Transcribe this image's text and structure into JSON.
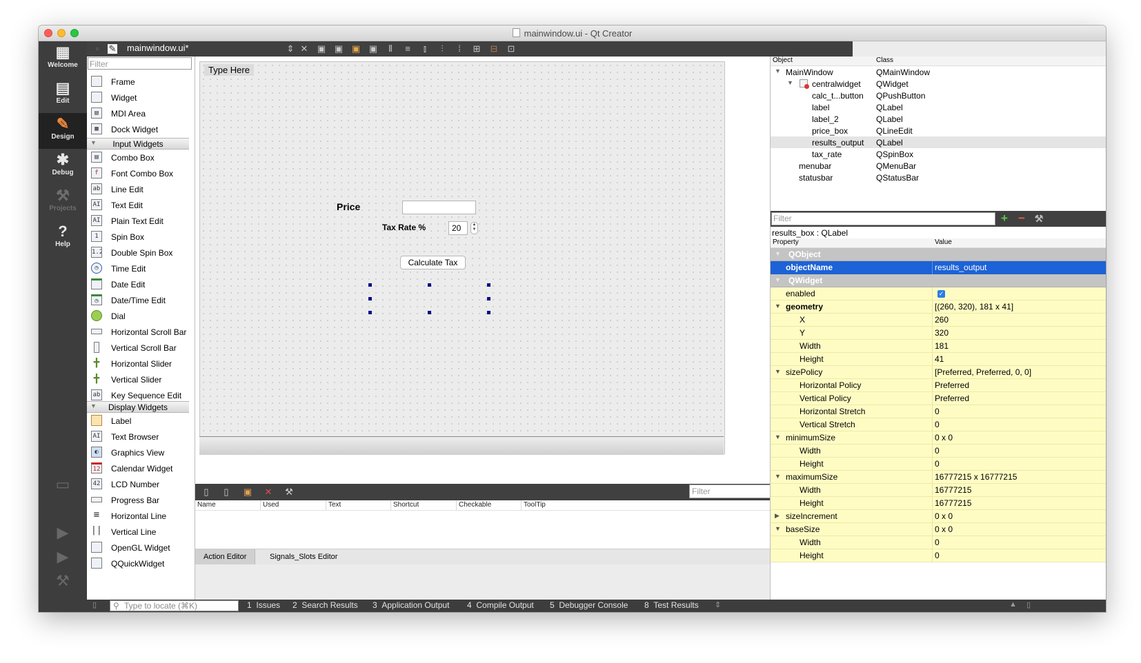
{
  "window": {
    "title": "mainwindow.ui - Qt Creator"
  },
  "modes": [
    {
      "label": "Welcome",
      "icon": "grid-icon",
      "glyph": "▦"
    },
    {
      "label": "Edit",
      "icon": "document-edit-icon",
      "glyph": "▤"
    },
    {
      "label": "Design",
      "icon": "pencil-icon",
      "glyph": "✎"
    },
    {
      "label": "Debug",
      "icon": "bug-icon",
      "glyph": "✱"
    },
    {
      "label": "Projects",
      "icon": "wrench-icon",
      "glyph": "⚒"
    },
    {
      "label": "Help",
      "icon": "help-icon",
      "glyph": "?"
    }
  ],
  "toolbar": {
    "file_name": "mainwindow.ui*"
  },
  "widget_box": {
    "filter_placeholder": "Filter",
    "items_top": [
      {
        "label": "Frame",
        "icon": "frame-icon"
      },
      {
        "label": "Widget",
        "icon": "widget-icon"
      },
      {
        "label": "MDI Area",
        "icon": "mdi-area-icon"
      },
      {
        "label": "Dock Widget",
        "icon": "dock-widget-icon"
      }
    ],
    "input_category": "Input Widgets",
    "input_items": [
      {
        "label": "Combo Box",
        "icon": "combo-box-icon"
      },
      {
        "label": "Font Combo Box",
        "icon": "font-combo-box-icon"
      },
      {
        "label": "Line Edit",
        "icon": "line-edit-icon"
      },
      {
        "label": "Text Edit",
        "icon": "text-edit-icon"
      },
      {
        "label": "Plain Text Edit",
        "icon": "plain-text-edit-icon"
      },
      {
        "label": "Spin Box",
        "icon": "spin-box-icon"
      },
      {
        "label": "Double Spin Box",
        "icon": "double-spin-box-icon"
      },
      {
        "label": "Time Edit",
        "icon": "clock-icon"
      },
      {
        "label": "Date Edit",
        "icon": "calendar-icon"
      },
      {
        "label": "Date/Time Edit",
        "icon": "calendar-clock-icon"
      },
      {
        "label": "Dial",
        "icon": "dial-icon"
      },
      {
        "label": "Horizontal Scroll Bar",
        "icon": "horizontal-scroll-bar-icon"
      },
      {
        "label": "Vertical Scroll Bar",
        "icon": "vertical-scroll-bar-icon"
      },
      {
        "label": "Horizontal Slider",
        "icon": "horizontal-slider-icon"
      },
      {
        "label": "Vertical Slider",
        "icon": "vertical-slider-icon"
      },
      {
        "label": "Key Sequence Edit",
        "icon": "key-sequence-edit-icon"
      }
    ],
    "display_category": "Display Widgets",
    "display_items": [
      {
        "label": "Label",
        "icon": "label-tag-icon"
      },
      {
        "label": "Text Browser",
        "icon": "text-browser-icon"
      },
      {
        "label": "Graphics View",
        "icon": "graphics-view-icon"
      },
      {
        "label": "Calendar Widget",
        "icon": "calendar-widget-icon"
      },
      {
        "label": "LCD Number",
        "icon": "lcd-number-icon"
      },
      {
        "label": "Progress Bar",
        "icon": "progress-bar-icon"
      },
      {
        "label": "Horizontal Line",
        "icon": "horizontal-line-icon"
      },
      {
        "label": "Vertical Line",
        "icon": "vertical-line-icon"
      },
      {
        "label": "OpenGL Widget",
        "icon": "opengl-widget-icon"
      },
      {
        "label": "QQuickWidget",
        "icon": "qquick-widget-icon"
      }
    ]
  },
  "form": {
    "menu_placeholder": "Type Here",
    "price_label": "Price",
    "tax_rate_label": "Tax Rate %",
    "tax_rate_value": "20",
    "calculate_button": "Calculate Tax"
  },
  "action_editor": {
    "filter_placeholder": "Filter",
    "columns": [
      "Name",
      "Used",
      "Text",
      "Shortcut",
      "Checkable",
      "ToolTip"
    ],
    "tabs": [
      "Action Editor",
      "Signals_Slots Editor"
    ]
  },
  "object_inspector": {
    "col_object": "Object",
    "col_class": "Class",
    "rows": [
      {
        "name": "MainWindow",
        "class": "QMainWindow"
      },
      {
        "name": "centralwidget",
        "class": "QWidget"
      },
      {
        "name": "calc_t...button",
        "class": "QPushButton"
      },
      {
        "name": "label",
        "class": "QLabel"
      },
      {
        "name": "label_2",
        "class": "QLabel"
      },
      {
        "name": "price_box",
        "class": "QLineEdit"
      },
      {
        "name": "results_output",
        "class": "QLabel"
      },
      {
        "name": "tax_rate",
        "class": "QSpinBox"
      },
      {
        "name": "menubar",
        "class": "QMenuBar"
      },
      {
        "name": "statusbar",
        "class": "QStatusBar"
      }
    ]
  },
  "property_editor": {
    "filter_placeholder": "Filter",
    "class_label": "results_box : QLabel",
    "col_property": "Property",
    "col_value": "Value",
    "rows": [
      {
        "name": "QObject",
        "value": ""
      },
      {
        "name": "objectName",
        "value": "results_output"
      },
      {
        "name": "QWidget",
        "value": ""
      },
      {
        "name": "enabled",
        "value": "✓"
      },
      {
        "name": "geometry",
        "value": "[(260, 320), 181 x 41]"
      },
      {
        "name": "X",
        "value": "260"
      },
      {
        "name": "Y",
        "value": "320"
      },
      {
        "name": "Width",
        "value": "181"
      },
      {
        "name": "Height",
        "value": "41"
      },
      {
        "name": "sizePolicy",
        "value": "[Preferred, Preferred, 0, 0]"
      },
      {
        "name": "Horizontal Policy",
        "value": "Preferred"
      },
      {
        "name": "Vertical Policy",
        "value": "Preferred"
      },
      {
        "name": "Horizontal Stretch",
        "value": "0"
      },
      {
        "name": "Vertical Stretch",
        "value": "0"
      },
      {
        "name": "minimumSize",
        "value": "0 x 0"
      },
      {
        "name": "Width",
        "value": "0"
      },
      {
        "name": "Height",
        "value": "0"
      },
      {
        "name": "maximumSize",
        "value": "16777215 x 16777215"
      },
      {
        "name": "Width",
        "value": "16777215"
      },
      {
        "name": "Height",
        "value": "16777215"
      },
      {
        "name": "sizeIncrement",
        "value": "0 x 0"
      },
      {
        "name": "baseSize",
        "value": "0 x 0"
      },
      {
        "name": "Width",
        "value": "0"
      },
      {
        "name": "Height",
        "value": "0"
      }
    ]
  },
  "bottom_bar": {
    "locator_placeholder": "Type to locate (⌘K)",
    "tabs": [
      {
        "num": "1",
        "label": "Issues"
      },
      {
        "num": "2",
        "label": "Search Results"
      },
      {
        "num": "3",
        "label": "Application Output"
      },
      {
        "num": "4",
        "label": "Compile Output"
      },
      {
        "num": "5",
        "label": "Debugger Console"
      },
      {
        "num": "8",
        "label": "Test Results"
      }
    ]
  },
  "colors": {
    "accent": "#1d62d6",
    "property_row": "#fefcc3",
    "dark_panel": "#3d3d3d"
  }
}
